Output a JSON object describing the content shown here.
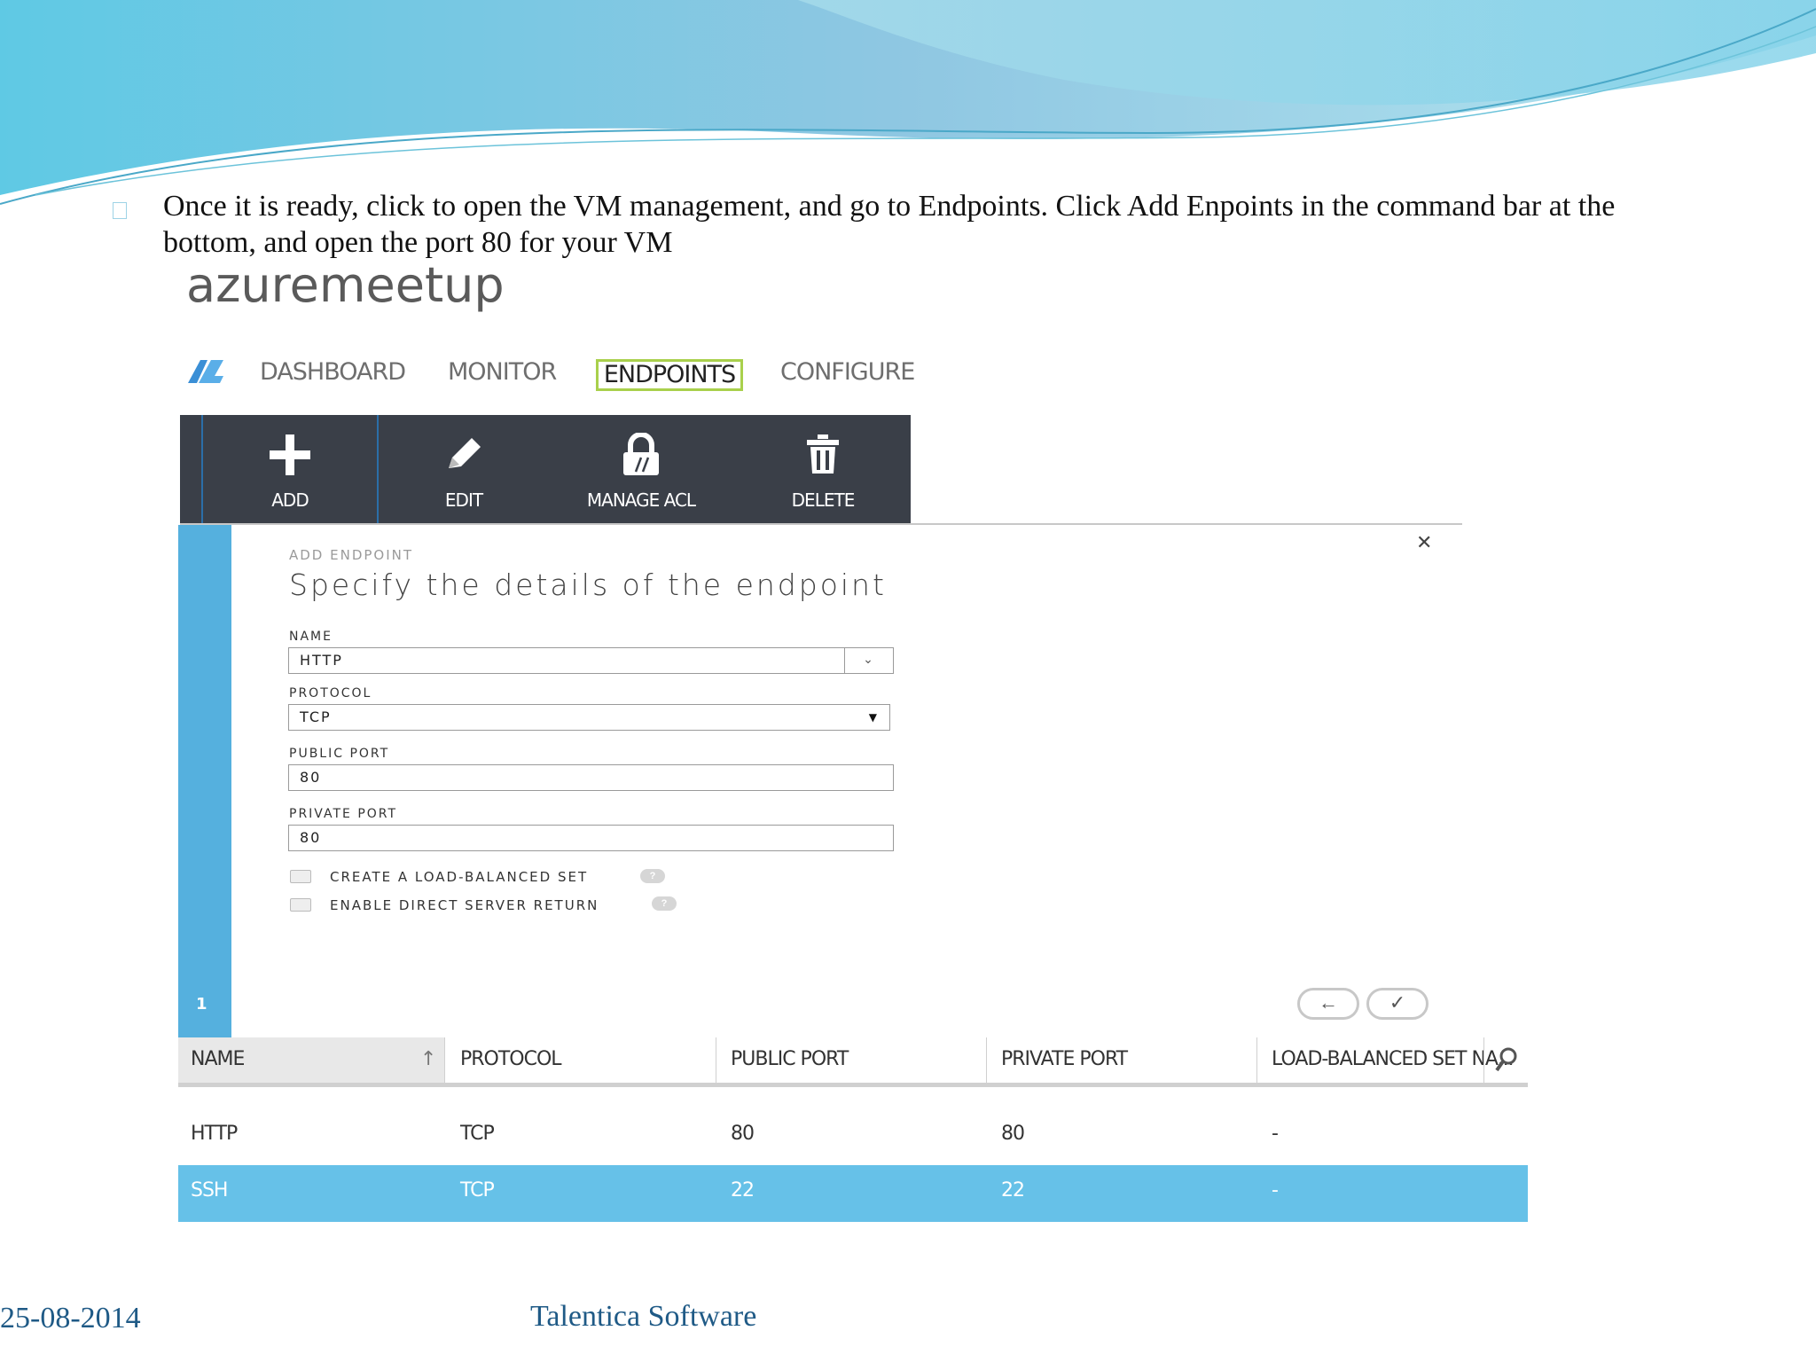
{
  "slide": {
    "bullet_text": "Once it is ready, click to open the VM management, and go to Endpoints. Click Add Enpoints in the command bar at the bottom, and open the port 80 for your VM",
    "footer_date": "25-08-2014",
    "footer_company": "Talentica Software"
  },
  "app": {
    "title": "azuremeetup",
    "nav": {
      "logo_icon": "azure-vm-icon",
      "items": [
        "DASHBOARD",
        "MONITOR",
        "ENDPOINTS",
        "CONFIGURE"
      ],
      "active": "ENDPOINTS"
    },
    "commands": [
      {
        "label": "ADD",
        "icon": "plus-icon"
      },
      {
        "label": "EDIT",
        "icon": "pencil-icon"
      },
      {
        "label": "MANAGE ACL",
        "icon": "lock-icon"
      },
      {
        "label": "DELETE",
        "icon": "trash-icon"
      }
    ]
  },
  "dialog": {
    "section": "ADD ENDPOINT",
    "title": "Specify the details of the endpoint",
    "step": "1",
    "fields": {
      "name": {
        "label": "NAME",
        "value": "HTTP"
      },
      "protocol": {
        "label": "PROTOCOL",
        "value": "TCP"
      },
      "public_port": {
        "label": "PUBLIC PORT",
        "value": "80"
      },
      "private_port": {
        "label": "PRIVATE PORT",
        "value": "80"
      }
    },
    "checkboxes": [
      {
        "label": "CREATE A LOAD-BALANCED SET",
        "checked": false
      },
      {
        "label": "ENABLE DIRECT SERVER RETURN",
        "checked": false
      }
    ]
  },
  "table": {
    "columns": [
      "NAME",
      "PROTOCOL",
      "PUBLIC PORT",
      "PRIVATE PORT",
      "LOAD-BALANCED SET NA..."
    ],
    "rows": [
      [
        "HTTP",
        "TCP",
        "80",
        "80",
        "-"
      ],
      [
        "SSH",
        "TCP",
        "22",
        "22",
        "-"
      ]
    ],
    "selected_row": 1
  },
  "colors": {
    "command_bar": "#3a3f48",
    "active_tab_border": "#a9d04c",
    "dialog_side": "#55b0de",
    "selected_row": "#66c1e8",
    "footer_text": "#1f5a86"
  }
}
